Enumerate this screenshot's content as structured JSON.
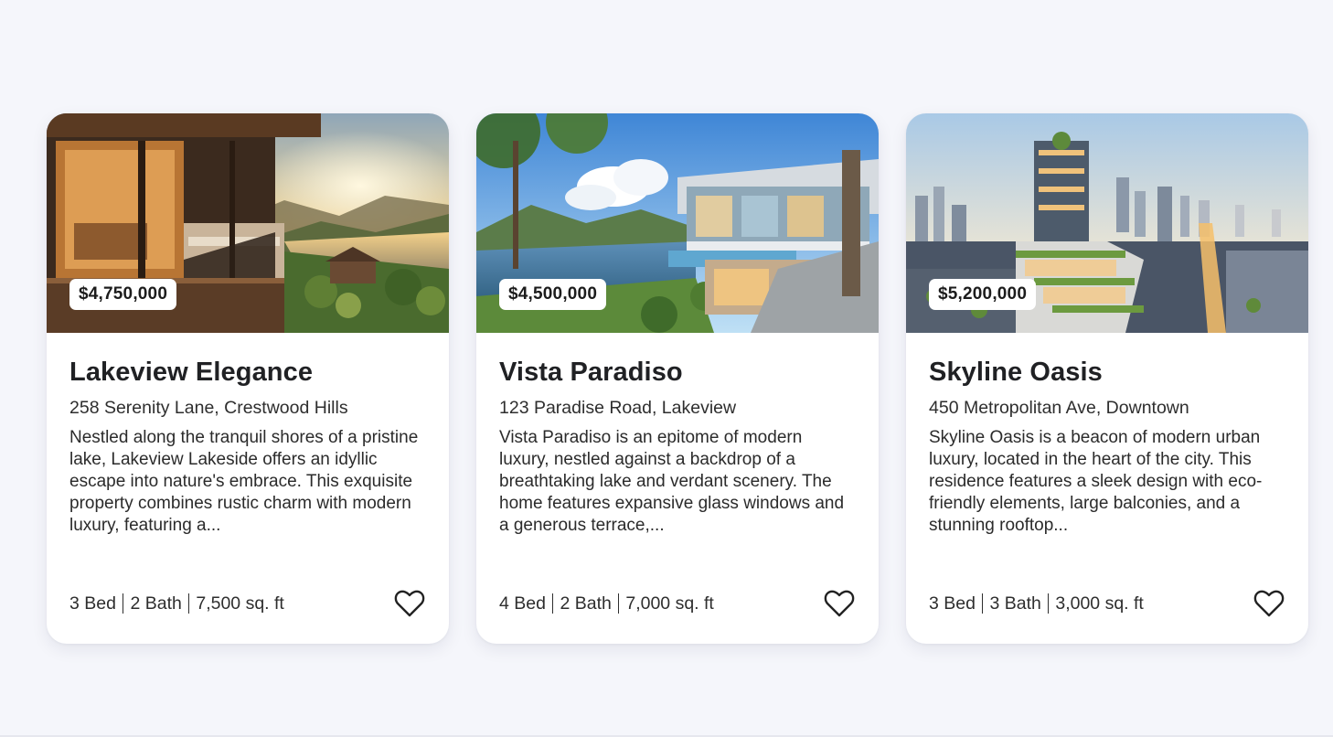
{
  "listings": [
    {
      "price": "$4,750,000",
      "title": "Lakeview Elegance",
      "address": "258 Serenity Lane, Crestwood Hills",
      "description": "Nestled along the tranquil shores of a pristine lake, Lakeview Lakeside offers an idyllic escape into nature's embrace. This exquisite property combines rustic charm with modern luxury, featuring a...",
      "beds": "3 Bed",
      "baths": "2 Bath",
      "area": "7,500 sq. ft",
      "favorite_icon": "heart-outline"
    },
    {
      "price": "$4,500,000",
      "title": "Vista Paradiso",
      "address": "123 Paradise Road, Lakeview",
      "description": "Vista Paradiso is an epitome of modern luxury, nestled against a backdrop of a breathtaking lake and verdant scenery. The home features expansive glass windows and a generous terrace,...",
      "beds": "4 Bed",
      "baths": "2 Bath",
      "area": "7,000 sq. ft",
      "favorite_icon": "heart-outline"
    },
    {
      "price": "$5,200,000",
      "title": "Skyline Oasis",
      "address": "450 Metropolitan Ave, Downtown",
      "description": "Skyline Oasis is a beacon of modern urban luxury, located in the heart of the city. This residence features a sleek design with eco-friendly elements, large balconies, and a stunning rooftop...",
      "beds": "3 Bed",
      "baths": "3 Bath",
      "area": "3,000 sq. ft",
      "favorite_icon": "heart-outline"
    }
  ],
  "colors": {
    "page_background": "#f5f6fb",
    "card_background": "#ffffff",
    "text_primary": "#202124",
    "text_secondary": "#2e2e2e"
  }
}
